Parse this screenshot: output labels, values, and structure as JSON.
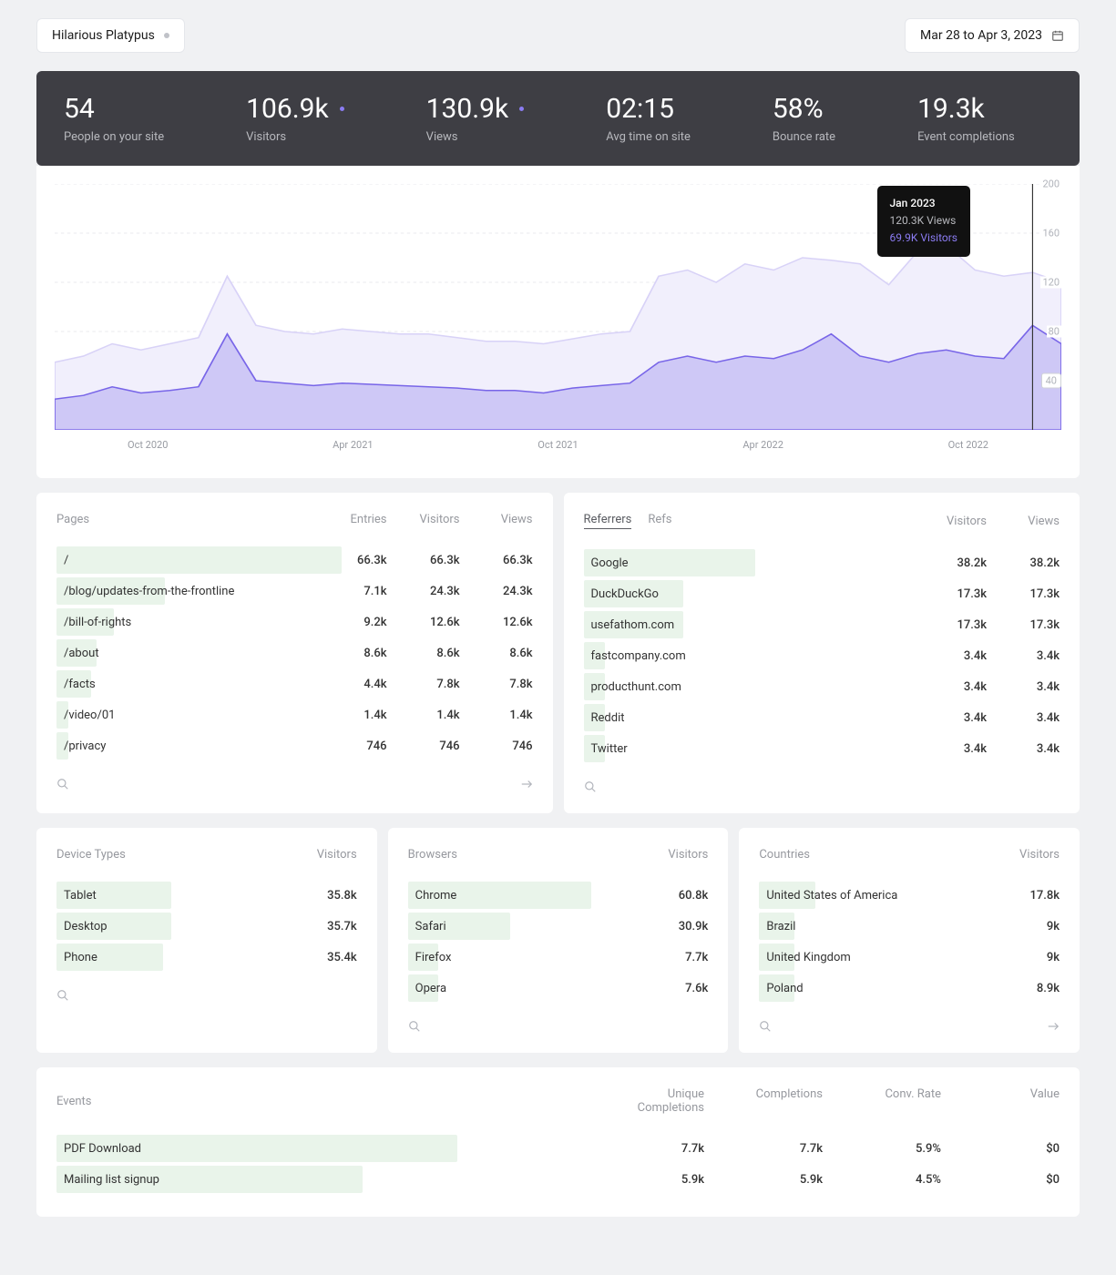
{
  "header": {
    "site_name": "Hilarious Platypus",
    "date_range": "Mar 28 to Apr 3, 2023"
  },
  "metrics": [
    {
      "value": "54",
      "label": "People on your site",
      "dot": false
    },
    {
      "value": "106.9k",
      "label": "Visitors",
      "dot": true
    },
    {
      "value": "130.9k",
      "label": "Views",
      "dot": true
    },
    {
      "value": "02:15",
      "label": "Avg time on site",
      "dot": false
    },
    {
      "value": "58%",
      "label": "Bounce rate",
      "dot": false
    },
    {
      "value": "19.3k",
      "label": "Event completions",
      "dot": false
    }
  ],
  "chart_data": {
    "type": "area",
    "x_ticks": [
      "Oct 2020",
      "Apr 2021",
      "Oct 2021",
      "Apr 2022",
      "Oct 2022"
    ],
    "y_ticks": [
      40,
      80,
      120,
      160,
      200
    ],
    "ylim": [
      0,
      200
    ],
    "series": [
      {
        "name": "Views",
        "color": "#e9e6fb",
        "values": [
          55,
          60,
          70,
          65,
          70,
          75,
          125,
          85,
          80,
          78,
          82,
          80,
          78,
          78,
          75,
          72,
          72,
          70,
          74,
          78,
          80,
          125,
          130,
          120,
          135,
          130,
          140,
          138,
          135,
          118,
          145,
          150,
          130,
          125,
          128,
          120
        ]
      },
      {
        "name": "Visitors",
        "color": "#8b7cf2",
        "values": [
          25,
          28,
          35,
          30,
          32,
          35,
          78,
          40,
          38,
          36,
          38,
          37,
          36,
          35,
          34,
          32,
          32,
          30,
          34,
          36,
          38,
          55,
          60,
          55,
          60,
          58,
          65,
          78,
          60,
          55,
          62,
          65,
          60,
          58,
          85,
          70
        ]
      }
    ],
    "tooltip": {
      "title": "Jan 2023",
      "views": "120.3K Views",
      "visitors": "69.9K Visitors",
      "index": 34
    }
  },
  "pages": {
    "title": "Pages",
    "cols": [
      "Entries",
      "Visitors",
      "Views"
    ],
    "rows": [
      {
        "label": "/",
        "bar": 100,
        "vals": [
          "66.3k",
          "66.3k",
          "66.3k"
        ]
      },
      {
        "label": "/blog/updates-from-the-frontline",
        "bar": 38,
        "vals": [
          "7.1k",
          "24.3k",
          "24.3k"
        ]
      },
      {
        "label": "/bill-of-rights",
        "bar": 20,
        "vals": [
          "9.2k",
          "12.6k",
          "12.6k"
        ]
      },
      {
        "label": "/about",
        "bar": 14,
        "vals": [
          "8.6k",
          "8.6k",
          "8.6k"
        ]
      },
      {
        "label": "/facts",
        "bar": 12,
        "vals": [
          "4.4k",
          "7.8k",
          "7.8k"
        ]
      },
      {
        "label": "/video/01",
        "bar": 4,
        "vals": [
          "1.4k",
          "1.4k",
          "1.4k"
        ]
      },
      {
        "label": "/privacy",
        "bar": 4,
        "vals": [
          "746",
          "746",
          "746"
        ]
      }
    ]
  },
  "referrers": {
    "tabs": [
      "Referrers",
      "Refs"
    ],
    "active_tab": 0,
    "cols": [
      "Visitors",
      "Views"
    ],
    "rows": [
      {
        "label": "Google",
        "bar": 48,
        "vals": [
          "38.2k",
          "38.2k"
        ]
      },
      {
        "label": "DuckDuckGo",
        "bar": 28,
        "vals": [
          "17.3k",
          "17.3k"
        ]
      },
      {
        "label": "usefathom.com",
        "bar": 28,
        "vals": [
          "17.3k",
          "17.3k"
        ]
      },
      {
        "label": "fastcompany.com",
        "bar": 6,
        "vals": [
          "3.4k",
          "3.4k"
        ]
      },
      {
        "label": "producthunt.com",
        "bar": 6,
        "vals": [
          "3.4k",
          "3.4k"
        ]
      },
      {
        "label": "Reddit",
        "bar": 6,
        "vals": [
          "3.4k",
          "3.4k"
        ]
      },
      {
        "label": "Twitter",
        "bar": 6,
        "vals": [
          "3.4k",
          "3.4k"
        ]
      }
    ]
  },
  "devices": {
    "title": "Device Types",
    "cols": [
      "Visitors"
    ],
    "rows": [
      {
        "label": "Tablet",
        "bar": 45,
        "vals": [
          "35.8k"
        ]
      },
      {
        "label": "Desktop",
        "bar": 45,
        "vals": [
          "35.7k"
        ]
      },
      {
        "label": "Phone",
        "bar": 42,
        "vals": [
          "35.4k"
        ]
      }
    ]
  },
  "browsers": {
    "title": "Browsers",
    "cols": [
      "Visitors"
    ],
    "rows": [
      {
        "label": "Chrome",
        "bar": 72,
        "vals": [
          "60.8k"
        ]
      },
      {
        "label": "Safari",
        "bar": 40,
        "vals": [
          "30.9k"
        ]
      },
      {
        "label": "Firefox",
        "bar": 12,
        "vals": [
          "7.7k"
        ]
      },
      {
        "label": "Opera",
        "bar": 12,
        "vals": [
          "7.6k"
        ]
      }
    ]
  },
  "countries": {
    "title": "Countries",
    "cols": [
      "Visitors"
    ],
    "rows": [
      {
        "label": "United States of America",
        "bar": 22,
        "vals": [
          "17.8k"
        ]
      },
      {
        "label": "Brazil",
        "bar": 14,
        "vals": [
          "9k"
        ]
      },
      {
        "label": "United Kingdom",
        "bar": 14,
        "vals": [
          "9k"
        ]
      },
      {
        "label": "Poland",
        "bar": 14,
        "vals": [
          "8.9k"
        ]
      }
    ]
  },
  "events": {
    "title": "Events",
    "cols": [
      "Unique Completions",
      "Completions",
      "Conv. Rate",
      "Value"
    ],
    "rows": [
      {
        "label": "PDF Download",
        "bar": 72,
        "vals": [
          "7.7k",
          "7.7k",
          "5.9%",
          "$0"
        ]
      },
      {
        "label": "Mailing list signup",
        "bar": 55,
        "vals": [
          "5.9k",
          "5.9k",
          "4.5%",
          "$0"
        ]
      }
    ]
  }
}
